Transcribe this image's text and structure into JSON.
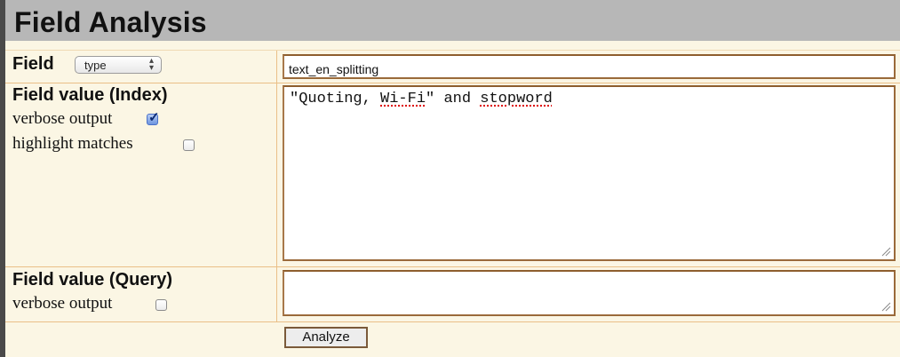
{
  "header": {
    "title": "Field Analysis"
  },
  "field_row": {
    "label": "Field",
    "select_value": "type",
    "input_value": "text_en_splitting"
  },
  "index_row": {
    "label": "Field value (Index)",
    "verbose_label": "verbose output",
    "verbose_checked": true,
    "highlight_label": "highlight matches",
    "highlight_checked": false,
    "text_parts": [
      "\"Quoting, ",
      "Wi-Fi",
      "\" and ",
      "stopword"
    ]
  },
  "query_row": {
    "label": "Field value (Query)",
    "verbose_label": "verbose output",
    "verbose_checked": false,
    "text": ""
  },
  "actions": {
    "analyze_label": "Analyze"
  },
  "colors": {
    "panel_bg": "#fbf6e4",
    "header_bg": "#b7b7b7",
    "divider": "#eabf87",
    "input_border": "#9a6a3a",
    "spellcheck": "#d00"
  }
}
